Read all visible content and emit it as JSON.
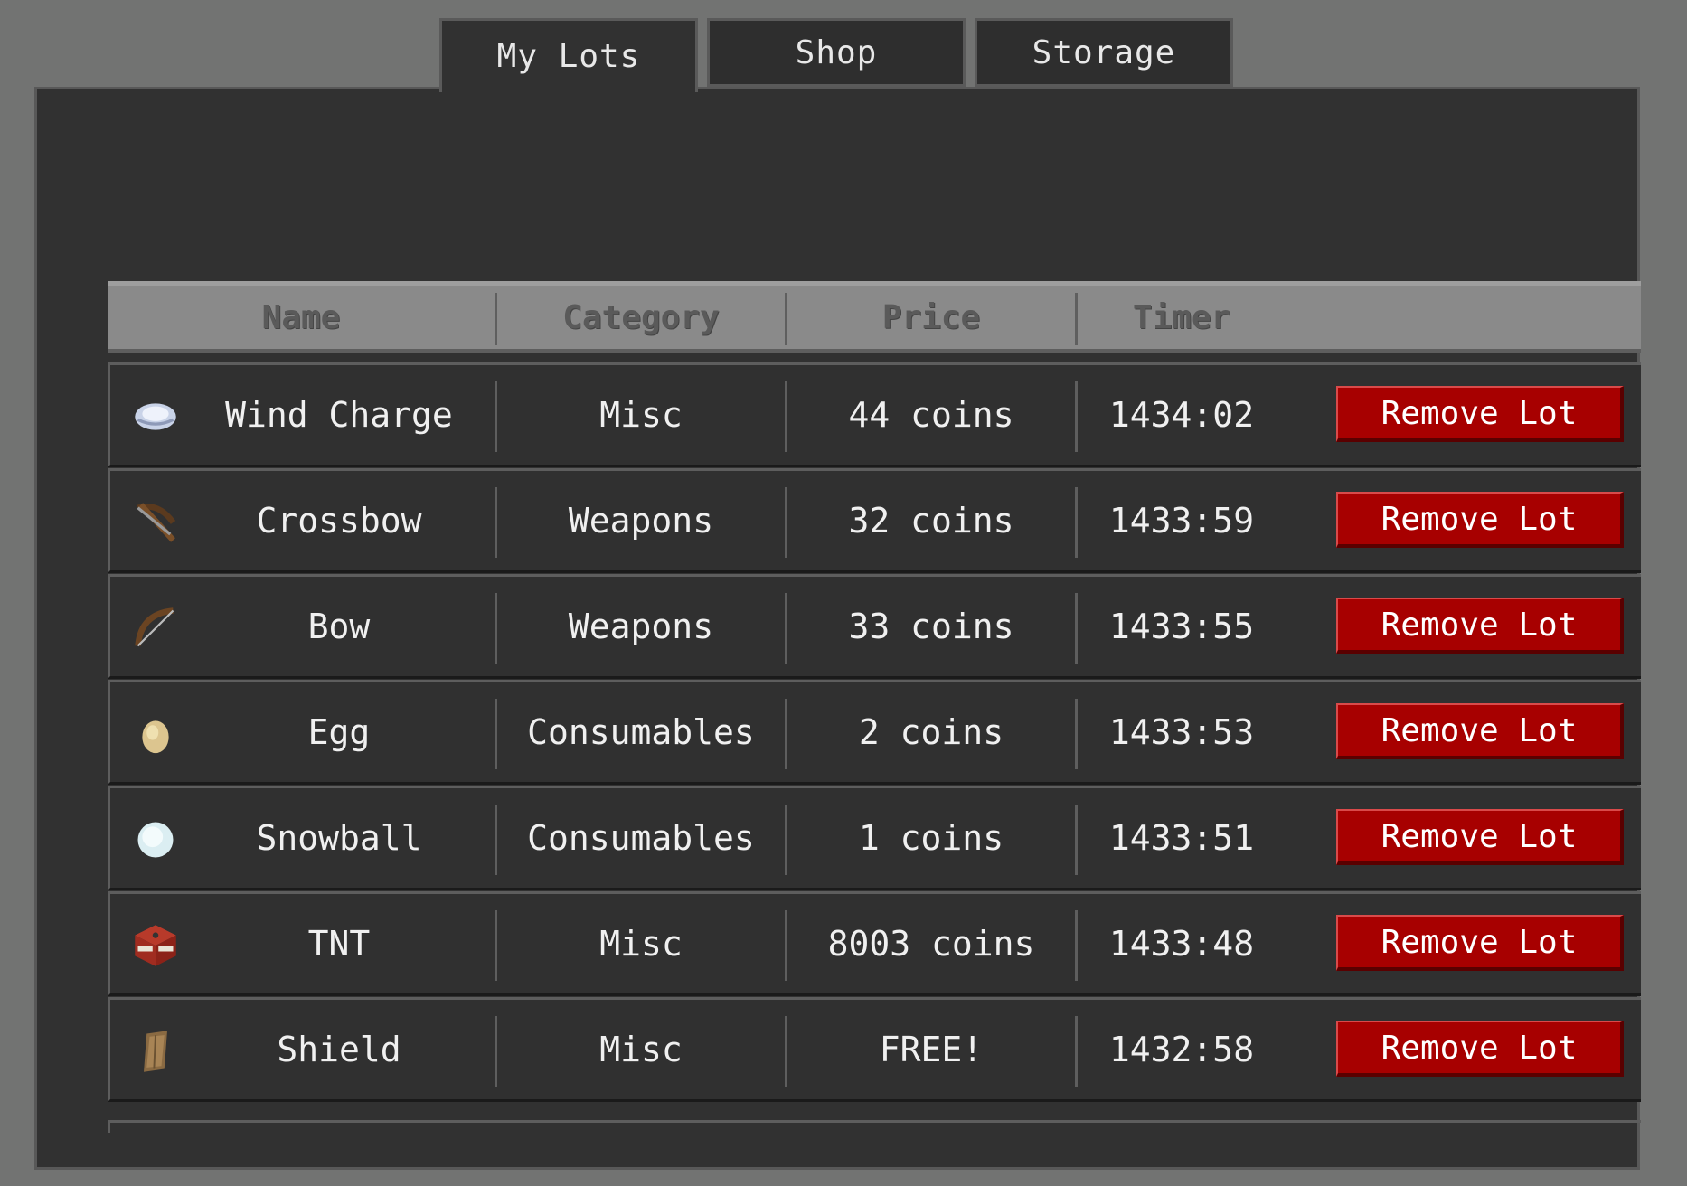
{
  "tabs": [
    {
      "label": "My Lots",
      "active": true
    },
    {
      "label": "Shop",
      "active": false
    },
    {
      "label": "Storage",
      "active": false
    }
  ],
  "columns": {
    "name": "Name",
    "category": "Category",
    "price": "Price",
    "timer": "Timer"
  },
  "rows": [
    {
      "icon": "wind-charge-icon",
      "name": "Wind Charge",
      "category": "Misc",
      "price": "44 coins",
      "timer": "1434:02",
      "action": "Remove Lot"
    },
    {
      "icon": "crossbow-icon",
      "name": "Crossbow",
      "category": "Weapons",
      "price": "32 coins",
      "timer": "1433:59",
      "action": "Remove Lot"
    },
    {
      "icon": "bow-icon",
      "name": "Bow",
      "category": "Weapons",
      "price": "33 coins",
      "timer": "1433:55",
      "action": "Remove Lot"
    },
    {
      "icon": "egg-icon",
      "name": "Egg",
      "category": "Consumables",
      "price": "2 coins",
      "timer": "1433:53",
      "action": "Remove Lot"
    },
    {
      "icon": "snowball-icon",
      "name": "Snowball",
      "category": "Consumables",
      "price": "1 coins",
      "timer": "1433:51",
      "action": "Remove Lot"
    },
    {
      "icon": "tnt-icon",
      "name": "TNT",
      "category": "Misc",
      "price": "8003 coins",
      "timer": "1433:48",
      "action": "Remove Lot"
    },
    {
      "icon": "shield-icon",
      "name": "Shield",
      "category": "Misc",
      "price": "FREE!",
      "timer": "1432:58",
      "action": "Remove Lot"
    }
  ],
  "colors": {
    "button": "#a70000",
    "panel": "#313131",
    "background": "#727372",
    "header": "#8a8a8a"
  }
}
